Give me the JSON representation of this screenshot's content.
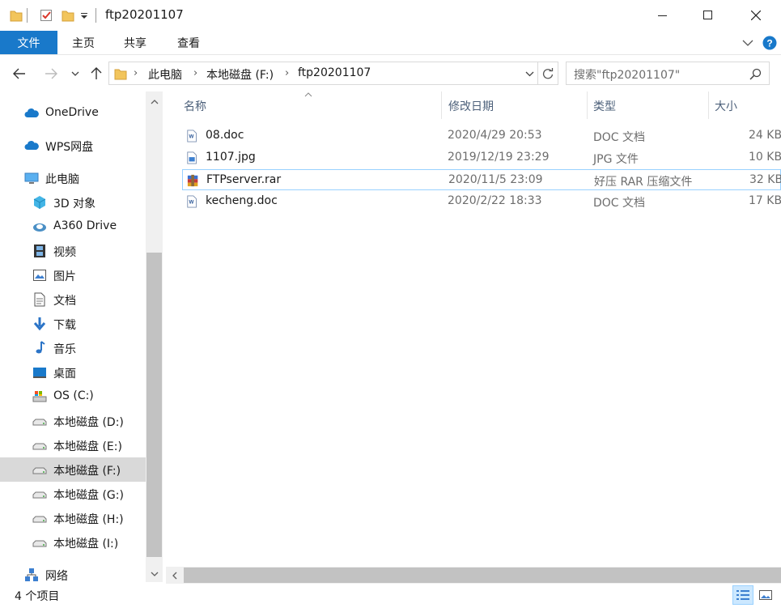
{
  "window": {
    "title": "ftp20201107"
  },
  "ribbon": {
    "tabs": [
      "文件",
      "主页",
      "共享",
      "查看"
    ]
  },
  "address": {
    "crumbs": [
      "此电脑",
      "本地磁盘 (F:)",
      "ftp20201107"
    ]
  },
  "search": {
    "placeholder": "搜索\"ftp20201107\""
  },
  "sidebar": {
    "items": [
      {
        "label": "OneDrive",
        "icon": "cloud-icon"
      },
      {
        "label": "WPS网盘",
        "icon": "cloud-icon"
      },
      {
        "label": "此电脑",
        "icon": "computer-icon"
      },
      {
        "label": "3D 对象",
        "icon": "cube-icon"
      },
      {
        "label": "A360 Drive",
        "icon": "a360-icon"
      },
      {
        "label": "视频",
        "icon": "film-icon"
      },
      {
        "label": "图片",
        "icon": "picture-icon"
      },
      {
        "label": "文档",
        "icon": "document-icon"
      },
      {
        "label": "下载",
        "icon": "download-arrow-icon"
      },
      {
        "label": "音乐",
        "icon": "music-note-icon"
      },
      {
        "label": "桌面",
        "icon": "desktop-icon"
      },
      {
        "label": "OS (C:)",
        "icon": "system-drive-icon"
      },
      {
        "label": "本地磁盘 (D:)",
        "icon": "drive-icon"
      },
      {
        "label": "本地磁盘 (E:)",
        "icon": "drive-icon"
      },
      {
        "label": "本地磁盘 (F:)",
        "icon": "drive-icon",
        "selected": true
      },
      {
        "label": "本地磁盘 (G:)",
        "icon": "drive-icon"
      },
      {
        "label": "本地磁盘 (H:)",
        "icon": "drive-icon"
      },
      {
        "label": "本地磁盘 (I:)",
        "icon": "drive-icon"
      },
      {
        "label": "网络",
        "icon": "network-icon"
      }
    ]
  },
  "columns": [
    "名称",
    "修改日期",
    "类型",
    "大小"
  ],
  "files": [
    {
      "name": "08.doc",
      "date": "2020/4/29 20:53",
      "type": "DOC 文档",
      "size": "24 KB",
      "icon": "word-doc-icon"
    },
    {
      "name": "1107.jpg",
      "date": "2019/12/19 23:29",
      "type": "JPG 文件",
      "size": "10 KB",
      "icon": "image-file-icon"
    },
    {
      "name": "FTPserver.rar",
      "date": "2020/11/5 23:09",
      "type": "好压 RAR 压缩文件",
      "size": "32 KB",
      "icon": "rar-archive-icon",
      "highlighted": true
    },
    {
      "name": "kecheng.doc",
      "date": "2020/2/22 18:33",
      "type": "DOC 文档",
      "size": "17 KB",
      "icon": "word-doc-icon"
    }
  ],
  "status": {
    "item_count": "4 个项目"
  },
  "colors": {
    "accent": "#1979ca",
    "selected_nav": "#d9d9d9",
    "highlight_border": "#99d1ff"
  }
}
